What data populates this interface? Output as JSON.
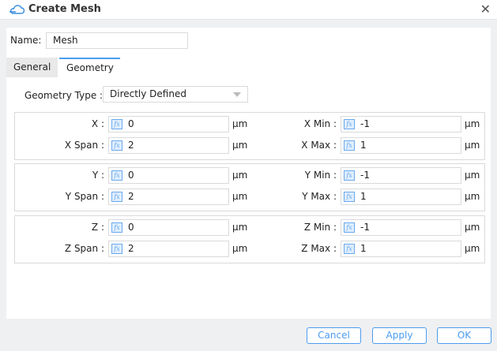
{
  "window": {
    "title": "Create Mesh"
  },
  "name": {
    "label": "Name:",
    "value": "Mesh"
  },
  "tabs": [
    {
      "label": "General"
    },
    {
      "label": "Geometry"
    }
  ],
  "geometry_type": {
    "label": "Geometry Type :",
    "value": "Directly Defined"
  },
  "groups": [
    {
      "center_label": "X :",
      "center": "0",
      "span_label": "X Span :",
      "span": "2",
      "min_label": "X Min :",
      "min": "-1",
      "max_label": "X Max :",
      "max": "1"
    },
    {
      "center_label": "Y :",
      "center": "0",
      "span_label": "Y Span :",
      "span": "2",
      "min_label": "Y Min :",
      "min": "-1",
      "max_label": "Y Max :",
      "max": "1"
    },
    {
      "center_label": "Z :",
      "center": "0",
      "span_label": "Z Span :",
      "span": "2",
      "min_label": "Z Min :",
      "min": "-1",
      "max_label": "Z Max :",
      "max": "1"
    }
  ],
  "unit": "μm",
  "fx_icon": "fx",
  "buttons": {
    "cancel": "Cancel",
    "apply": "Apply",
    "ok": "OK"
  },
  "colors": {
    "accent": "#4a9cf0"
  }
}
